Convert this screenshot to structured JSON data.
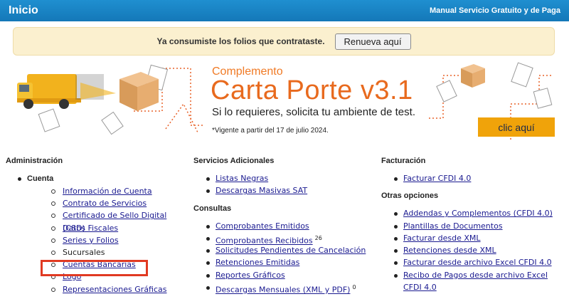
{
  "topbar": {
    "title": "Inicio",
    "manual": "Manual Servicio Gratuito y de Paga"
  },
  "notice": {
    "message": "Ya consumiste los folios que contrataste.",
    "button": "Renueva aquí"
  },
  "banner": {
    "kicker": "Complemento",
    "title": "Carta Porte v3.1",
    "subtitle": "Si lo requieres, solicita tu ambiente de test.",
    "note": "*Vigente a partir del 17 de julio 2024.",
    "cta": "clic aquí",
    "colors": {
      "orange": "#e86a1e",
      "cta": "#f0a30a",
      "truck": "#f2b21d"
    }
  },
  "admin": {
    "heading": "Administración",
    "group": "Cuenta",
    "items": [
      {
        "label": "Información de Cuenta",
        "link": true
      },
      {
        "label": "Contrato de Servicios",
        "link": true
      },
      {
        "label": "Certificado de Sello Digital (CSD)",
        "link": true
      },
      {
        "label": "Datos Fiscales",
        "link": true
      },
      {
        "label": "Series y Folios",
        "link": true
      },
      {
        "label": "Sucursales",
        "link": false
      },
      {
        "label": "Cuentas Bancarias",
        "link": true
      },
      {
        "label": "Logo",
        "link": true
      },
      {
        "label": "Representaciones Gráficas",
        "link": true
      }
    ]
  },
  "servicios": {
    "heading": "Servicios Adicionales",
    "items": [
      "Listas Negras",
      "Descargas Masivas SAT"
    ]
  },
  "consultas": {
    "heading": "Consultas",
    "items": [
      {
        "label": "Comprobantes Emitidos",
        "badge": ""
      },
      {
        "label": "Comprobantes Recibidos",
        "badge": "26"
      },
      {
        "label": "Solicitudes Pendientes de Cancelación",
        "badge": ""
      },
      {
        "label": "Retenciones Emitidas",
        "badge": ""
      },
      {
        "label": "Reportes Gráficos",
        "badge": ""
      },
      {
        "label": "Descargas Mensuales (XML y PDF)",
        "badge": "0"
      }
    ]
  },
  "facturacion": {
    "heading": "Facturación",
    "items": [
      "Facturar CFDI 4.0"
    ]
  },
  "otras": {
    "heading": "Otras opciones",
    "items": [
      "Addendas y Complementos (CFDI 4.0)",
      "Plantillas de Documentos",
      "Facturar desde XML",
      "Retenciones desde XML",
      "Facturar desde archivo Excel CFDI 4.0",
      "Recibo de Pagos desde archivo Excel CFDI 4.0"
    ]
  }
}
